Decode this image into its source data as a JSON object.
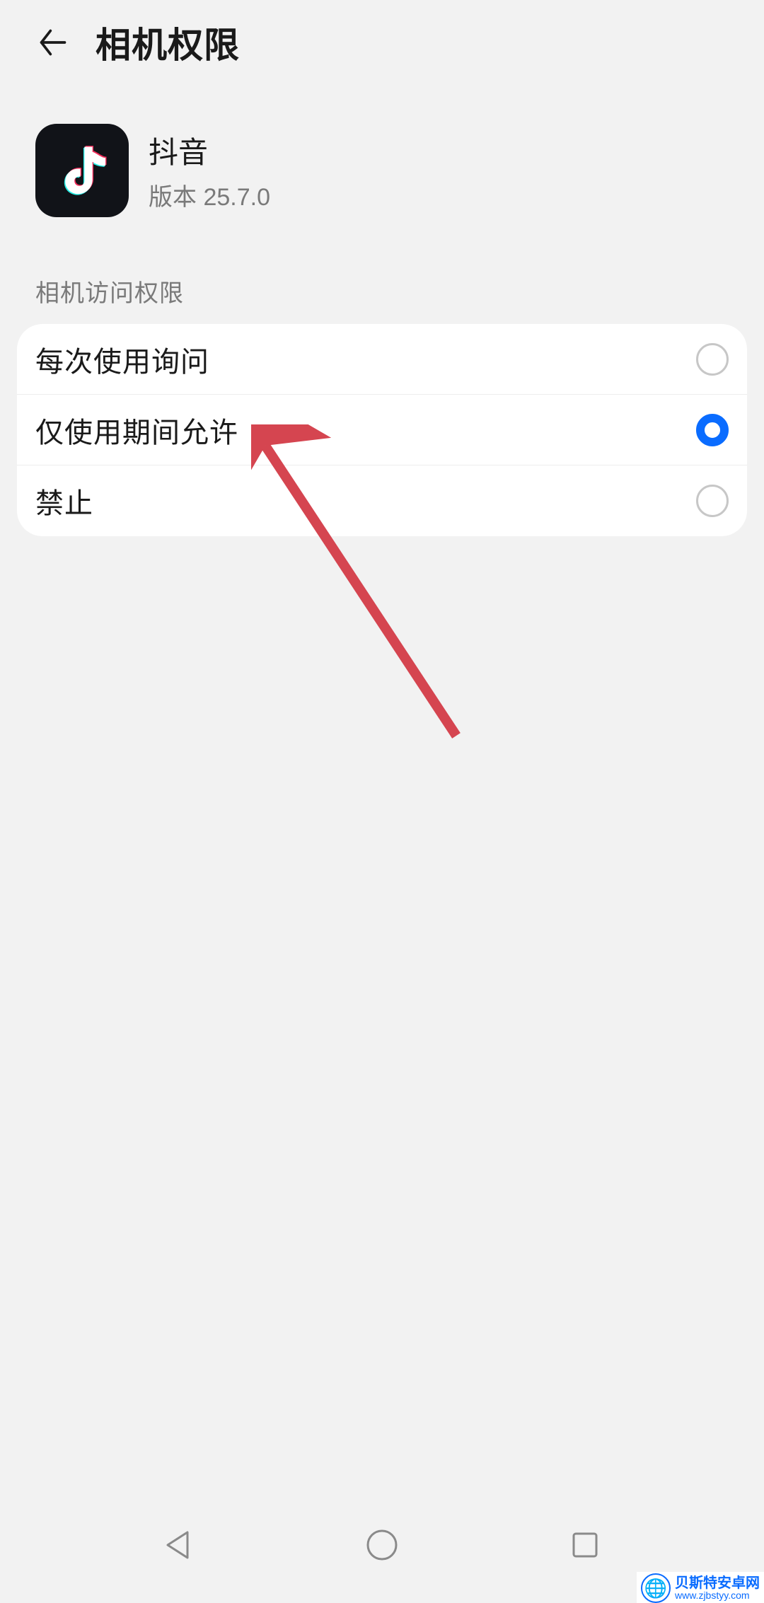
{
  "header": {
    "title": "相机权限"
  },
  "app": {
    "name": "抖音",
    "version": "版本 25.7.0",
    "icon_name": "douyin-icon"
  },
  "section": {
    "label": "相机访问权限"
  },
  "options": [
    {
      "label": "每次使用询问",
      "checked": false
    },
    {
      "label": "仅使用期间允许",
      "checked": true
    },
    {
      "label": "禁止",
      "checked": false
    }
  ],
  "watermark": {
    "title": "贝斯特安卓网",
    "sub": "www.zjbstyy.com"
  },
  "colors": {
    "accent": "#0a6cff",
    "arrow": "#d54550"
  }
}
